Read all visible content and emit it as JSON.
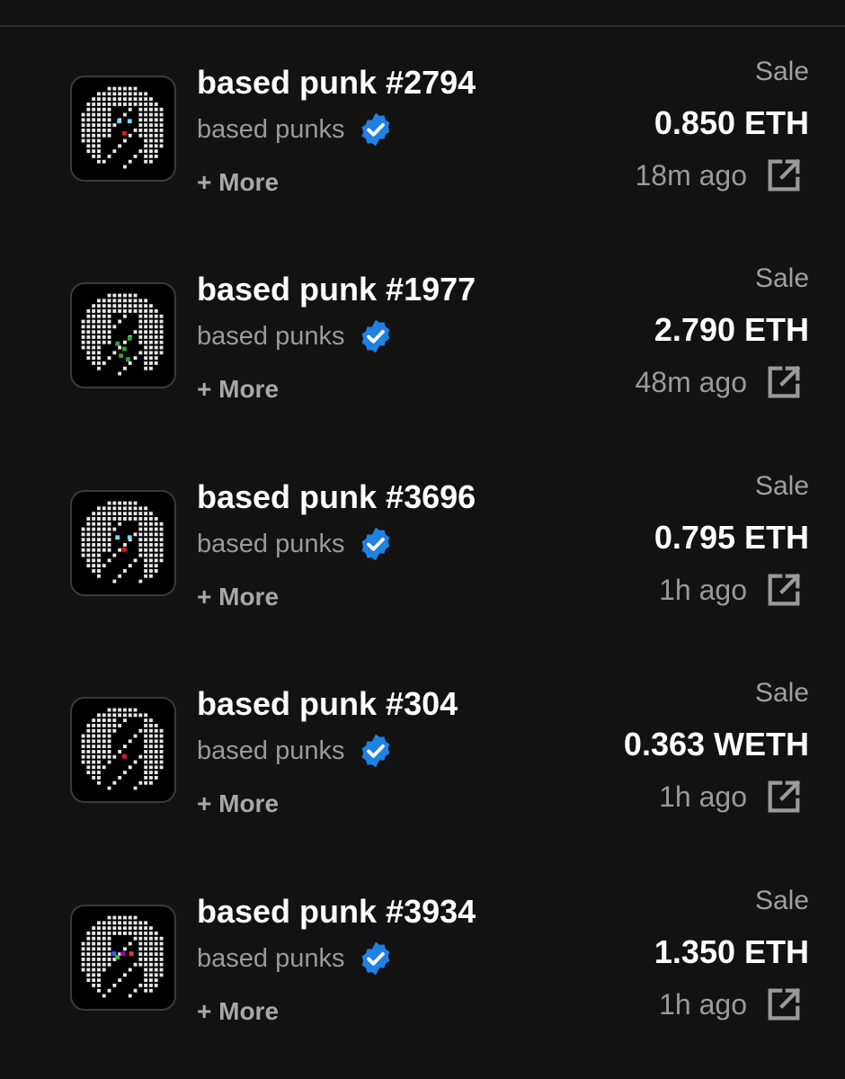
{
  "colors": {
    "background": "#121212",
    "verified_badge": "#2081E2",
    "muted_text": "#9a9a9a"
  },
  "activity": [
    {
      "name": "based punk #2794",
      "collection": "based punks",
      "more": "+ More",
      "event": "Sale",
      "price": "0.850 ETH",
      "time": "18m ago",
      "icons": {
        "badge": "verified-badge-icon",
        "link": "external-link-icon"
      }
    },
    {
      "name": "based punk #1977",
      "collection": "based punks",
      "more": "+ More",
      "event": "Sale",
      "price": "2.790 ETH",
      "time": "48m ago",
      "icons": {
        "badge": "verified-badge-icon",
        "link": "external-link-icon"
      }
    },
    {
      "name": "based punk #3696",
      "collection": "based punks",
      "more": "+ More",
      "event": "Sale",
      "price": "0.795 ETH",
      "time": "1h ago",
      "icons": {
        "badge": "verified-badge-icon",
        "link": "external-link-icon"
      }
    },
    {
      "name": "based punk #304",
      "collection": "based punks",
      "more": "+ More",
      "event": "Sale",
      "price": "0.363 WETH",
      "time": "1h ago",
      "icons": {
        "badge": "verified-badge-icon",
        "link": "external-link-icon"
      }
    },
    {
      "name": "based punk #3934",
      "collection": "based punks",
      "more": "+ More",
      "event": "Sale",
      "price": "1.350 ETH",
      "time": "1h ago",
      "icons": {
        "badge": "verified-badge-icon",
        "link": "external-link-icon"
      }
    }
  ]
}
